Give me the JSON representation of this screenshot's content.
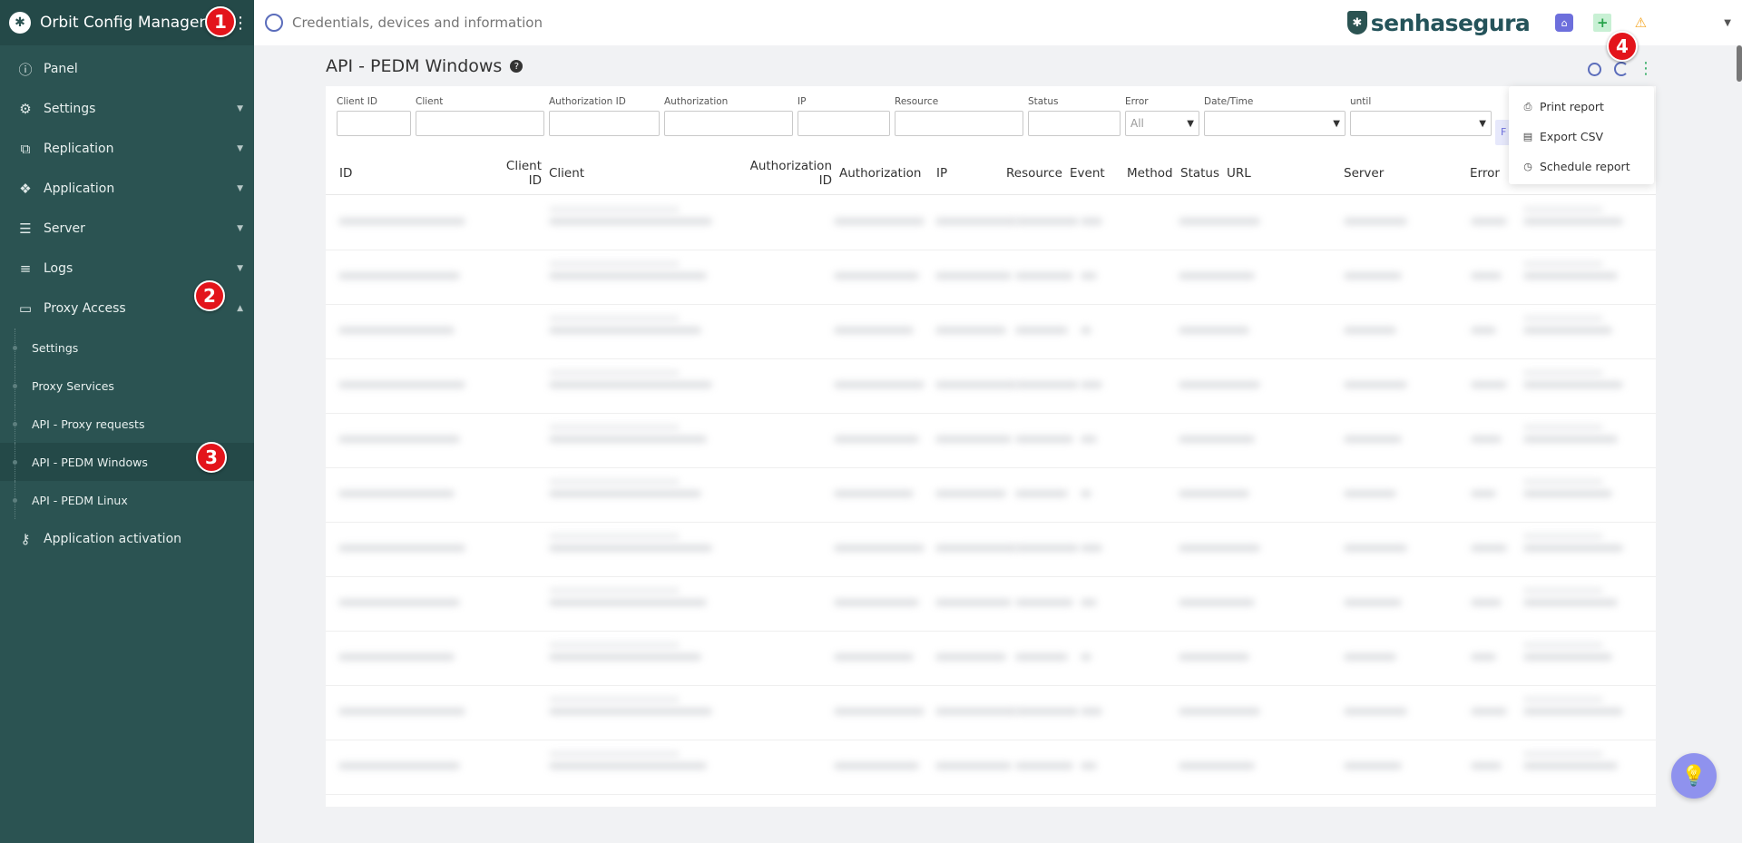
{
  "app": {
    "title": "Orbit Config Manager",
    "brand_text": "senhasegura",
    "search_placeholder": "Credentials, devices and information"
  },
  "sidebar": {
    "items": [
      {
        "label": "Panel",
        "icon": "info-icon"
      },
      {
        "label": "Settings",
        "icon": "gears-icon"
      },
      {
        "label": "Replication",
        "icon": "copy-icon"
      },
      {
        "label": "Application",
        "icon": "cubes-icon"
      },
      {
        "label": "Server",
        "icon": "server-icon"
      },
      {
        "label": "Logs",
        "icon": "list-icon"
      },
      {
        "label": "Proxy Access",
        "icon": "monitor-icon"
      }
    ],
    "proxy_sub": [
      {
        "label": "Settings"
      },
      {
        "label": "Proxy Services"
      },
      {
        "label": "API - Proxy requests"
      },
      {
        "label": "API - PEDM Windows",
        "active": true
      },
      {
        "label": "API - PEDM Linux"
      }
    ],
    "activation": {
      "label": "Application activation",
      "icon": "key-icon"
    }
  },
  "annotations": [
    "1",
    "2",
    "3",
    "4"
  ],
  "page": {
    "title": "API - PEDM Windows"
  },
  "filters": [
    {
      "label": "Client ID",
      "value": ""
    },
    {
      "label": "Client",
      "value": ""
    },
    {
      "label": "Authorization ID",
      "value": ""
    },
    {
      "label": "Authorization",
      "value": ""
    },
    {
      "label": "IP",
      "value": ""
    },
    {
      "label": "Resource",
      "value": ""
    },
    {
      "label": "Status",
      "value": ""
    },
    {
      "label": "Error",
      "value": "All"
    },
    {
      "label": "Date/Time",
      "value": ""
    },
    {
      "label": "until",
      "value": ""
    }
  ],
  "filter_button": "F",
  "table": {
    "columns": [
      "ID",
      "Client ID",
      "Client",
      "Authorization ID",
      "Authorization",
      "IP",
      "Resource",
      "Event",
      "Method",
      "Status",
      "URL",
      "Server",
      "Error"
    ]
  },
  "menu": {
    "items": [
      {
        "label": "Print report",
        "icon": "printer-icon"
      },
      {
        "label": "Export CSV",
        "icon": "file-icon"
      },
      {
        "label": "Schedule report",
        "icon": "clock-icon"
      }
    ]
  },
  "colors": {
    "sidebar": "#2b5352",
    "accent": "#6d6fdc",
    "badge": "#e3141b"
  }
}
